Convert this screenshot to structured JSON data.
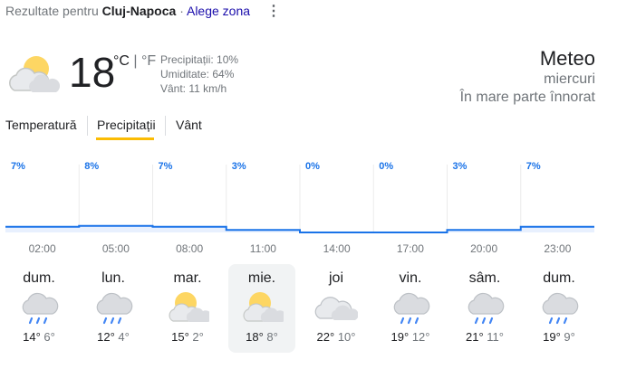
{
  "header": {
    "prefix": "Rezultate pentru",
    "location": "Cluj-Napoca",
    "sep": " · ",
    "change_zone": "Alege zona",
    "more": "⋮"
  },
  "current": {
    "icon": "partly-cloudy-icon",
    "temp": "18",
    "unit_c": "°C",
    "unit_sep": "|",
    "unit_f": "°F",
    "precip": "Precipitații: 10%",
    "humidity": "Umiditate: 64%",
    "wind": "Vânt: 11 km/h",
    "title": "Meteo",
    "day": "miercuri",
    "condition": "În mare parte înnorat"
  },
  "tabs": [
    "Temperatură",
    "Precipitații",
    "Vânt"
  ],
  "chart_data": {
    "type": "area",
    "series": [
      {
        "values": [
          7,
          8,
          7,
          3,
          0,
          0,
          3,
          7
        ]
      }
    ],
    "value_labels": [
      "7%",
      "8%",
      "7%",
      "3%",
      "0%",
      "0%",
      "3%",
      "7%"
    ],
    "x": [
      "02:00",
      "05:00",
      "08:00",
      "11:00",
      "14:00",
      "17:00",
      "20:00",
      "23:00"
    ],
    "ylim": [
      0,
      100
    ],
    "color": "#1a73e8"
  },
  "forecast": [
    {
      "day": "dum.",
      "icon": "rain-icon",
      "hi": "14°",
      "lo": "6°"
    },
    {
      "day": "lun.",
      "icon": "rain-icon",
      "hi": "12°",
      "lo": "4°"
    },
    {
      "day": "mar.",
      "icon": "partly-cloudy-icon",
      "hi": "15°",
      "lo": "2°"
    },
    {
      "day": "mie.",
      "icon": "partly-cloudy-icon",
      "hi": "18°",
      "lo": "8°"
    },
    {
      "day": "joi",
      "icon": "cloudy-icon",
      "hi": "22°",
      "lo": "10°"
    },
    {
      "day": "vin.",
      "icon": "rain-icon",
      "hi": "19°",
      "lo": "12°"
    },
    {
      "day": "sâm.",
      "icon": "rain-icon",
      "hi": "21°",
      "lo": "11°"
    },
    {
      "day": "dum.",
      "icon": "rain-icon",
      "hi": "19°",
      "lo": "9°"
    }
  ]
}
